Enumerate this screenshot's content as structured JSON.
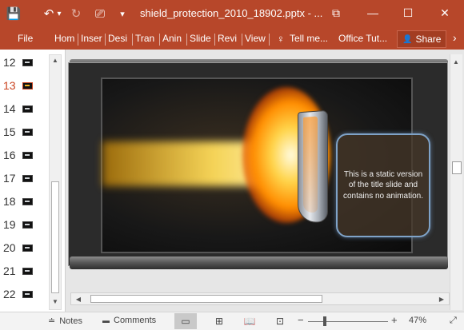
{
  "window": {
    "title": "shield_protection_2010_18902.pptx - ...",
    "restore_glyph": "⧉",
    "minimize_glyph": "—",
    "maximize_glyph": "☐",
    "close_glyph": "✕"
  },
  "quick_access": {
    "save_icon": "💾",
    "undo_icon": "↶",
    "undo_dropdown": "▾",
    "redo_icon": "↻",
    "present_icon": "⎚",
    "customize_icon": "▾"
  },
  "ribbon": {
    "file": "File",
    "tabs": [
      "Hom",
      "Inser",
      "Desi",
      "Tran",
      "Anin",
      "Slide",
      "Revi",
      "View"
    ],
    "tell_me": "Tell me...",
    "tell_me_icon": "♀",
    "office_tutorials": "Office Tut...",
    "share": "Share",
    "share_icon": "👤",
    "ribbon_expand": "›"
  },
  "thumbnails": [
    {
      "num": "12",
      "active": false
    },
    {
      "num": "13",
      "active": true
    },
    {
      "num": "14",
      "active": false
    },
    {
      "num": "15",
      "active": false
    },
    {
      "num": "16",
      "active": false
    },
    {
      "num": "17",
      "active": false
    },
    {
      "num": "18",
      "active": false
    },
    {
      "num": "19",
      "active": false
    },
    {
      "num": "20",
      "active": false
    },
    {
      "num": "21",
      "active": false
    },
    {
      "num": "22",
      "active": false
    }
  ],
  "slide": {
    "text": "This is a static version of the title slide and contains no animation."
  },
  "statusbar": {
    "notes": "Notes",
    "notes_icon": "≐",
    "comments": "Comments",
    "comments_icon": "▬",
    "normal_view_icon": "▭",
    "sorter_view_icon": "⊞",
    "reading_view_icon": "📖",
    "slideshow_icon": "⊡",
    "zoom_out": "−",
    "zoom_in": "+",
    "zoom_level": "47%",
    "fit_icon": "⤢"
  },
  "scroll": {
    "up": "▲",
    "down": "▼",
    "left": "◀",
    "right": "▶"
  }
}
